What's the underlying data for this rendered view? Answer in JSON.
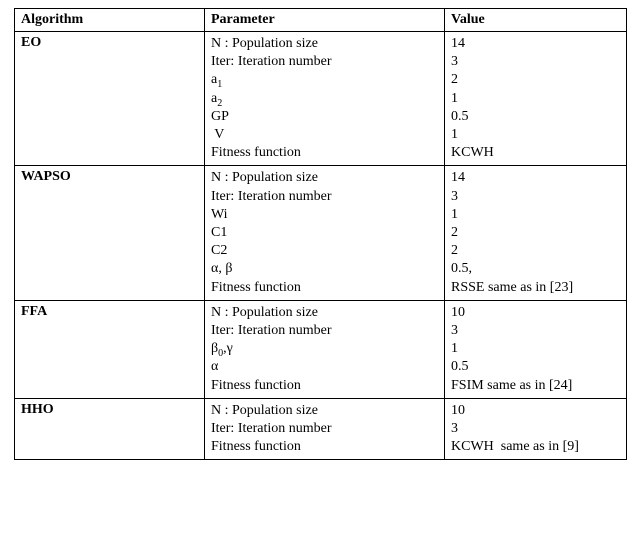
{
  "headers": {
    "alg": "Algorithm",
    "param": "Parameter",
    "val": "Value"
  },
  "groups": [
    {
      "alg": "EO",
      "rows": [
        {
          "param": {
            "text": "N : Population size"
          },
          "val": "14"
        },
        {
          "param": {
            "text": "Iter: Iteration number"
          },
          "val": "3"
        },
        {
          "param": {
            "text": "a",
            "sub": "1"
          },
          "val": "2"
        },
        {
          "param": {
            "text": "a",
            "sub": "2"
          },
          "val": "1"
        },
        {
          "param": {
            "text": "GP"
          },
          "val": "0.5"
        },
        {
          "param": {
            "text": " V"
          },
          "val": "1"
        },
        {
          "param": {
            "text": "Fitness function"
          },
          "val": "KCWH"
        }
      ]
    },
    {
      "alg": "WAPSO",
      "rows": [
        {
          "param": {
            "text": "N : Population size"
          },
          "val": "14"
        },
        {
          "param": {
            "text": "Iter: Iteration number"
          },
          "val": "3"
        },
        {
          "param": {
            "text": "Wi"
          },
          "val": "1"
        },
        {
          "param": {
            "text": "C1"
          },
          "val": "2"
        },
        {
          "param": {
            "text": "C2"
          },
          "val": "2"
        },
        {
          "param": {
            "text": "α, β"
          },
          "val": "0.5,"
        },
        {
          "param": {
            "text": "Fitness function"
          },
          "val": "RSSE same as in [23]"
        }
      ]
    },
    {
      "alg": "FFA",
      "rows": [
        {
          "param": {
            "text": "N : Population size"
          },
          "val": "10"
        },
        {
          "param": {
            "text": "Iter: Iteration number"
          },
          "val": "3"
        },
        {
          "param": {
            "text": "β",
            "sub": "0",
            "tail": ",γ"
          },
          "val": "1"
        },
        {
          "param": {
            "text": "α"
          },
          "val": "0.5"
        },
        {
          "param": {
            "text": "Fitness function"
          },
          "val": "FSIM same as in [24]"
        }
      ]
    },
    {
      "alg": "HHO",
      "rows": [
        {
          "param": {
            "text": "N : Population size"
          },
          "val": "10"
        },
        {
          "param": {
            "text": "Iter: Iteration number"
          },
          "val": "3"
        },
        {
          "param": {
            "text": "Fitness function"
          },
          "val": "KCWH  same as in [9]"
        }
      ]
    }
  ]
}
